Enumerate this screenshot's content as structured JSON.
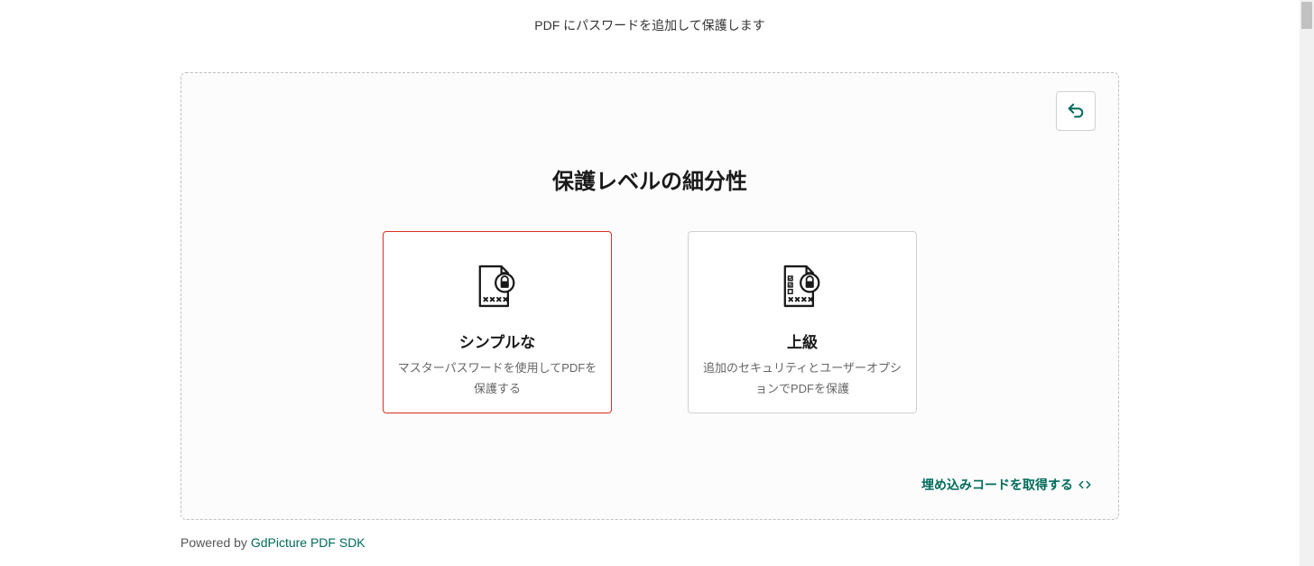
{
  "header": {
    "subtitle": "PDF にパスワードを追加して保護します"
  },
  "panel": {
    "title": "保護レベルの細分性",
    "back_label": "back",
    "options": {
      "simple": {
        "title": "シンプルな",
        "desc": "マスターパスワードを使用してPDFを保護する"
      },
      "advanced": {
        "title": "上級",
        "desc": "追加のセキュリティとユーザーオプションでPDFを保護"
      }
    },
    "embed_link": "埋め込みコードを取得する"
  },
  "footer": {
    "prefix": "Powered by ",
    "link_text": "GdPicture PDF SDK"
  },
  "colors": {
    "accent": "#006b5b",
    "selected_border": "#d93025"
  }
}
